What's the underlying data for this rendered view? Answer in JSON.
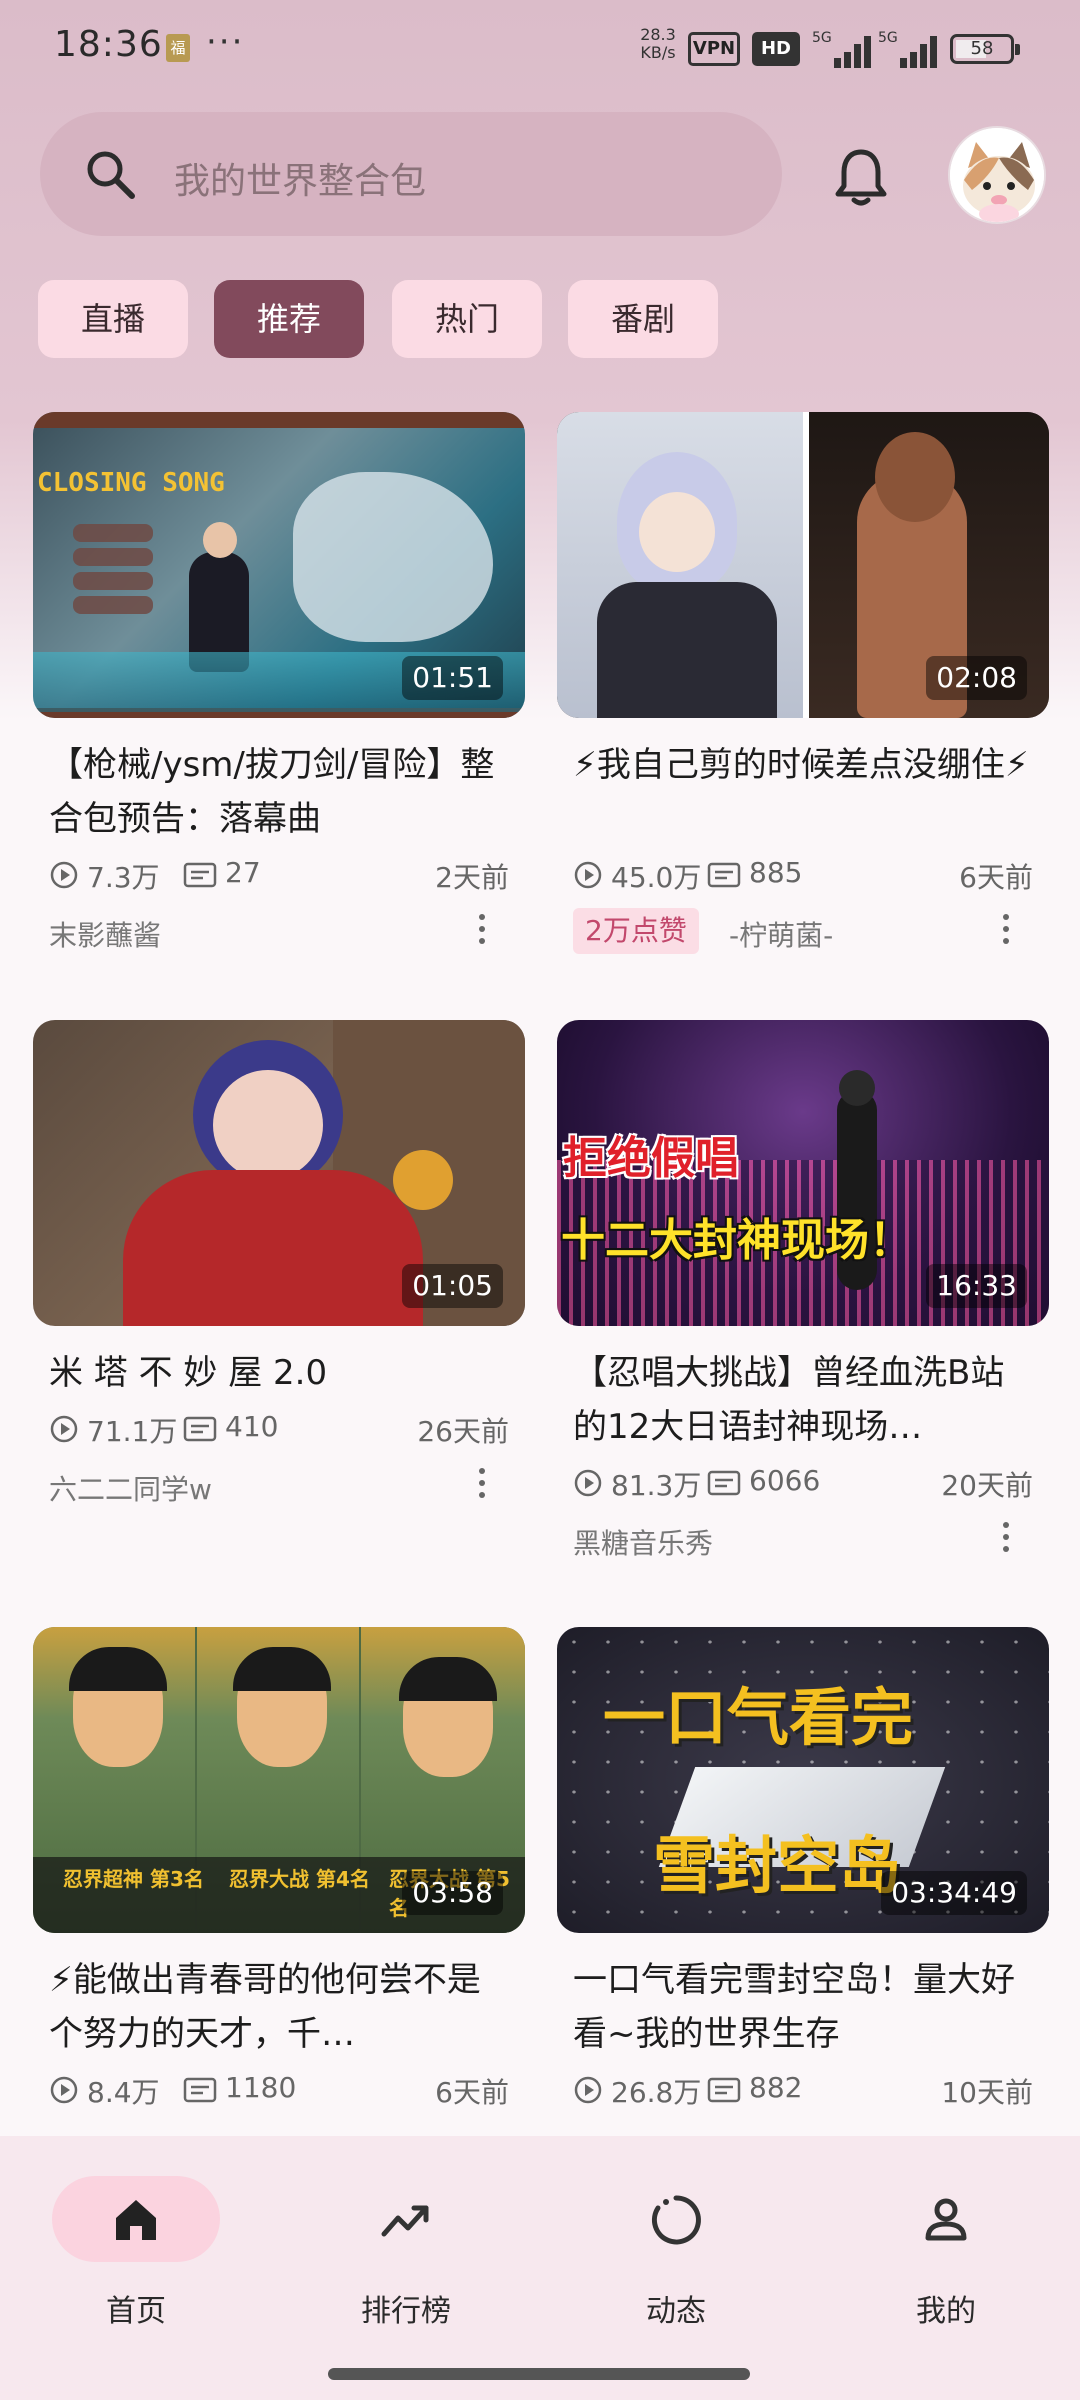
{
  "status_bar": {
    "time": "18:36",
    "fu_badge": "福",
    "dots": "···",
    "net_speed_value": "28.3",
    "net_speed_unit": "KB/s",
    "vpn": "VPN",
    "hd": "HD",
    "signal1_label": "5G",
    "signal2_label": "5G",
    "battery": "58",
    "battery_level": 0.58
  },
  "header": {
    "search_placeholder": "我的世界整合包",
    "icons": [
      "search-icon",
      "bell-icon",
      "avatar"
    ]
  },
  "tabs": [
    {
      "label": "直播",
      "active": false
    },
    {
      "label": "推荐",
      "active": true
    },
    {
      "label": "热门",
      "active": false
    },
    {
      "label": "番剧",
      "active": false
    }
  ],
  "videos": [
    {
      "duration": "01:51",
      "thumb_text": "CLOSING SONG",
      "title": "【枪械/ysm/拔刀剑/冒险】整合包预告：落幕曲",
      "views": "7.3万",
      "danmaku": "27",
      "ago": "2天前",
      "author": "末影蘸酱",
      "badge": ""
    },
    {
      "duration": "02:08",
      "title": "⚡我自己剪的时候差点没绷住⚡",
      "views": "45.0万",
      "danmaku": "885",
      "ago": "6天前",
      "author": "-柠萌菌-",
      "badge": "2万点赞"
    },
    {
      "duration": "01:05",
      "title": "米 塔 不 妙 屋 2.0",
      "views": "71.1万",
      "danmaku": "410",
      "ago": "26天前",
      "author": "六二二同学w",
      "badge": ""
    },
    {
      "duration": "16:33",
      "thumb_text_1": "拒绝假唱",
      "thumb_text_2": "十二大封神现场！",
      "title": "【忍唱大挑战】曾经血洗B站的12大日语封神现场…",
      "views": "81.3万",
      "danmaku": "6066",
      "ago": "20天前",
      "author": "黑糖音乐秀",
      "badge": ""
    },
    {
      "duration": "03:58",
      "thumb_ranks": [
        "忍界超神 第3名",
        "忍界大战 第4名",
        "忍界大战 第5名"
      ],
      "title": "⚡能做出青春哥的他何尝不是个努力的天才，千…",
      "views": "8.4万",
      "danmaku": "1180",
      "ago": "6天前",
      "author": "",
      "badge": ""
    },
    {
      "duration": "03:34:49",
      "thumb_text_1": "一口气看完",
      "thumb_text_2": "雪封空岛",
      "title": "一口气看完雪封空岛！量大好看~我的世界生存",
      "views": "26.8万",
      "danmaku": "882",
      "ago": "10天前",
      "author": "",
      "badge": ""
    }
  ],
  "bottom_nav": [
    {
      "label": "首页",
      "icon": "home-icon",
      "active": true
    },
    {
      "label": "排行榜",
      "icon": "trending-icon",
      "active": false
    },
    {
      "label": "动态",
      "icon": "activity-icon",
      "active": false
    },
    {
      "label": "我的",
      "icon": "profile-icon",
      "active": false
    }
  ],
  "colors": {
    "accent": "#824a5c",
    "tab_bg": "#fbdbe4",
    "nav_active_pill": "#fbd3df",
    "badge_text": "#c2486c"
  }
}
